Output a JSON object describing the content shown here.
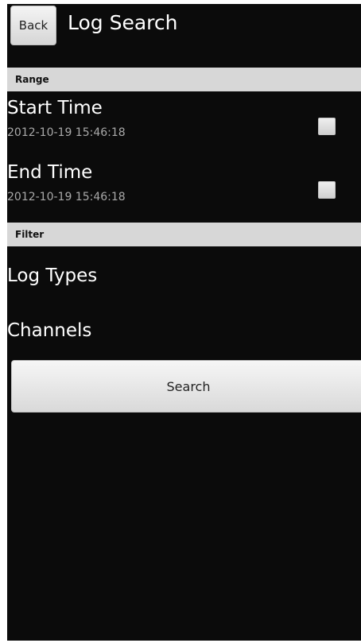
{
  "action_bar": {
    "back_label": "Back",
    "title": "Log Search"
  },
  "sections": {
    "range_label": "Range",
    "filter_label": "Filter"
  },
  "range": {
    "start": {
      "title": "Start Time",
      "value": "2012-10-19 15:46:18",
      "checked": false
    },
    "end": {
      "title": "End Time",
      "value": "2012-10-19 15:46:18",
      "checked": false
    }
  },
  "filter": {
    "log_types_label": "Log Types",
    "channels_label": "Channels"
  },
  "search_button_label": "Search",
  "colors": {
    "background": "#0b0b0b",
    "section_header": "#d7d7d7",
    "primary_text": "#ffffff",
    "secondary_text": "#a9a9a9"
  }
}
